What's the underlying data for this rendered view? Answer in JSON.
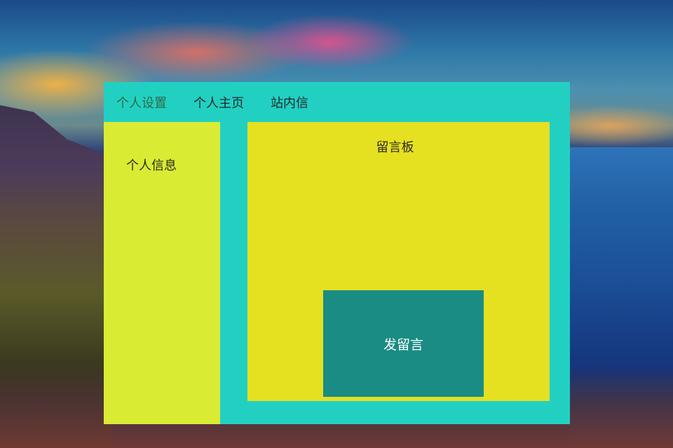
{
  "nav": {
    "items": [
      {
        "label": "个人设置"
      },
      {
        "label": "个人主页"
      },
      {
        "label": "站内信"
      }
    ]
  },
  "sidebar": {
    "title": "个人信息"
  },
  "board": {
    "title": "留言板",
    "post_button_label": "发留言"
  },
  "colors": {
    "frame": "#22d0c2",
    "sidebar": "#d9ec33",
    "board": "#e5e020",
    "post_button": "#1a8c84",
    "active_nav": "#2d6a4a"
  }
}
